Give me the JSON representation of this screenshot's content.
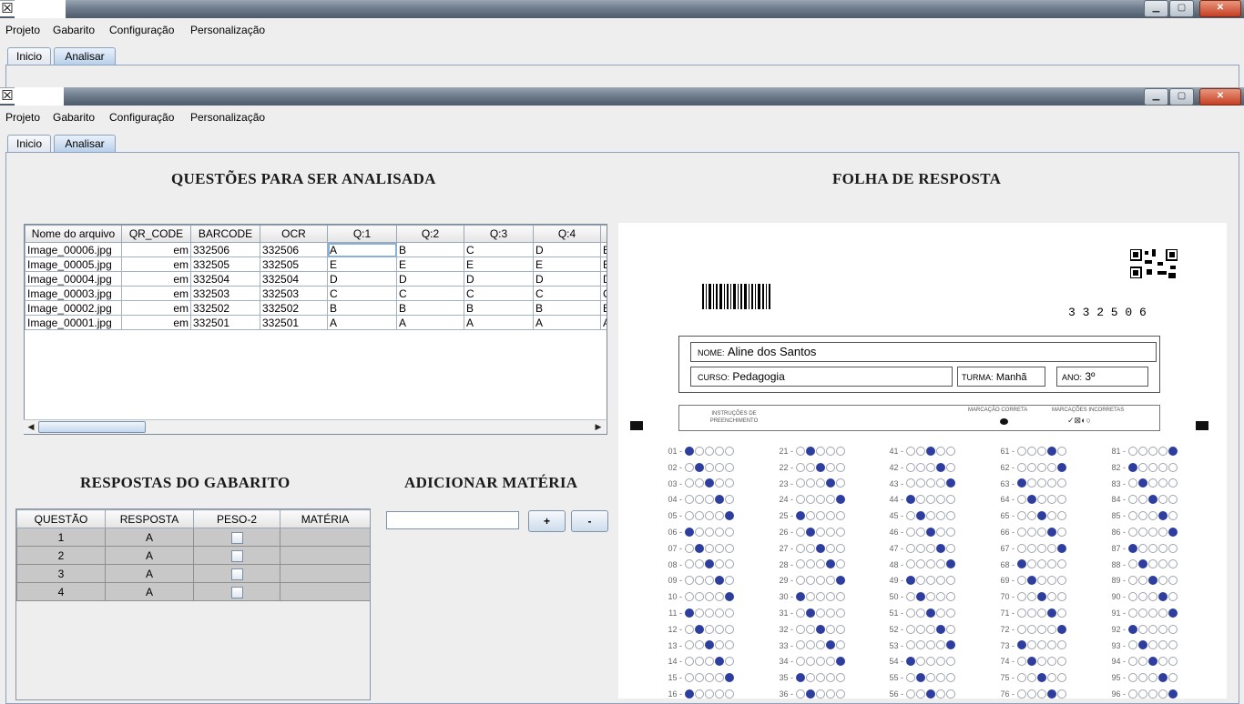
{
  "menu": [
    "Projeto",
    "Gabarito",
    "Configuração",
    "Personalização"
  ],
  "tabs": [
    "Inicio",
    "Analisar"
  ],
  "headings": {
    "questoes": "QUESTÕES PARA SER ANALISADA",
    "folha": "FOLHA DE RESPOSTA",
    "respostas": "RESPOSTAS DO GABARITO",
    "adicionar": "ADICIONAR MATÉRIA"
  },
  "file_table": {
    "columns": [
      "Nome do arquivo",
      "QR_CODE",
      "BARCODE",
      "OCR",
      "Q:1",
      "Q:2",
      "Q:3",
      "Q:4"
    ],
    "rows": [
      [
        "Image_00006.jpg",
        "em",
        "332506",
        "332506",
        "A",
        "B",
        "C",
        "D",
        "E"
      ],
      [
        "Image_00005.jpg",
        "em",
        "332505",
        "332505",
        "E",
        "E",
        "E",
        "E",
        "E"
      ],
      [
        "Image_00004.jpg",
        "em",
        "332504",
        "332504",
        "D",
        "D",
        "D",
        "D",
        "D"
      ],
      [
        "Image_00003.jpg",
        "em",
        "332503",
        "332503",
        "C",
        "C",
        "C",
        "C",
        "C"
      ],
      [
        "Image_00002.jpg",
        "em",
        "332502",
        "332502",
        "B",
        "B",
        "B",
        "B",
        "B"
      ],
      [
        "Image_00001.jpg",
        "em",
        "332501",
        "332501",
        "A",
        "A",
        "A",
        "A",
        "A"
      ]
    ]
  },
  "gabarito": {
    "columns": [
      "QUESTÃO",
      "RESPOSTA",
      "PESO-2",
      "MATÉRIA"
    ],
    "rows": [
      {
        "questao": "1",
        "resposta": "A"
      },
      {
        "questao": "2",
        "resposta": "A"
      },
      {
        "questao": "3",
        "resposta": "A"
      },
      {
        "questao": "4",
        "resposta": "A"
      }
    ]
  },
  "materia_input": "",
  "buttons": {
    "add": "+",
    "remove": "-"
  },
  "sheet": {
    "number": "3 3 2 5 0 6",
    "nome_label": "NOME:",
    "nome": "Aline dos Santos",
    "curso_label": "CURSO:",
    "curso": "Pedagogia",
    "turma_label": "TURMA:",
    "turma": "Manhã",
    "ano_label": "ANO:",
    "ano": "3º",
    "instr_label": "INSTRUÇÕES DE PREENCHIMENTO",
    "marcacao_correta": "MARCAÇÃO CORRETA",
    "marcacoes_incorretas": "MARCAÇÕES INCORRETAS",
    "fill_color": "#2e3e9e"
  }
}
